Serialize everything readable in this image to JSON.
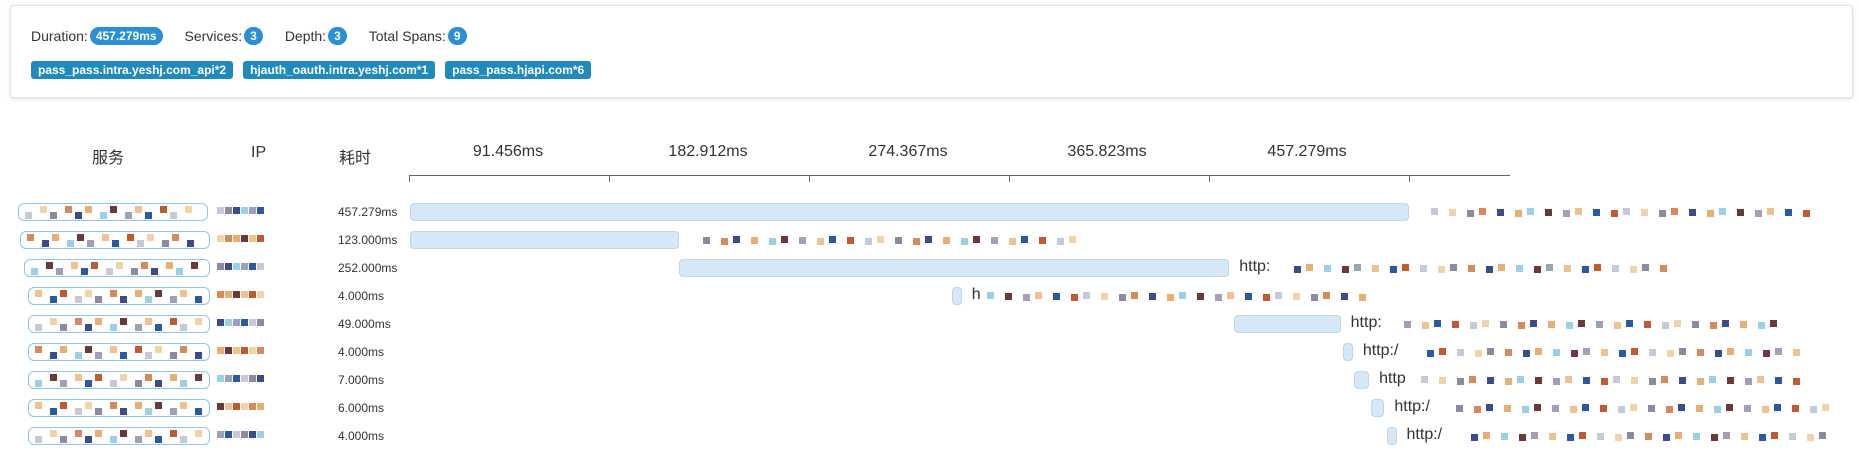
{
  "summary": {
    "duration_label": "Duration:",
    "duration_value": "457.279ms",
    "services_label": "Services:",
    "services_value": "3",
    "depth_label": "Depth:",
    "depth_value": "3",
    "spans_label": "Total Spans:",
    "spans_value": "9"
  },
  "tags": [
    "pass_pass.intra.yeshj.com_api*2",
    "hjauth_oauth.intra.yeshj.com*1",
    "pass_pass.hjapi.com*6"
  ],
  "columns": {
    "service": "服务",
    "ip": "IP",
    "duration": "耗时"
  },
  "timeline": {
    "max_ms": 457.279,
    "ticks": [
      "91.456ms",
      "182.912ms",
      "274.367ms",
      "365.823ms",
      "457.279ms"
    ]
  },
  "spans": [
    {
      "duration": "457.279ms",
      "start_ms": 0,
      "duration_ms": 457.279,
      "url": ""
    },
    {
      "duration": "123.000ms",
      "start_ms": 0,
      "duration_ms": 123.0,
      "url": ""
    },
    {
      "duration": "252.000ms",
      "start_ms": 123.0,
      "duration_ms": 252.0,
      "url": "http:"
    },
    {
      "duration": "4.000ms",
      "start_ms": 248.0,
      "duration_ms": 4.0,
      "url": "h"
    },
    {
      "duration": "49.000ms",
      "start_ms": 377.0,
      "duration_ms": 49.0,
      "url": "http:"
    },
    {
      "duration": "4.000ms",
      "start_ms": 427.0,
      "duration_ms": 4.0,
      "url": "http:/"
    },
    {
      "duration": "7.000ms",
      "start_ms": 432.0,
      "duration_ms": 7.0,
      "url": "http"
    },
    {
      "duration": "6.000ms",
      "start_ms": 440.0,
      "duration_ms": 6.0,
      "url": "http:/"
    },
    {
      "duration": "4.000ms",
      "start_ms": 447.0,
      "duration_ms": 4.0,
      "url": "http:/"
    }
  ],
  "colors": {
    "badge": "#2b8fd6",
    "tag": "#1f8bbd",
    "bar": "#d6e7f6"
  }
}
